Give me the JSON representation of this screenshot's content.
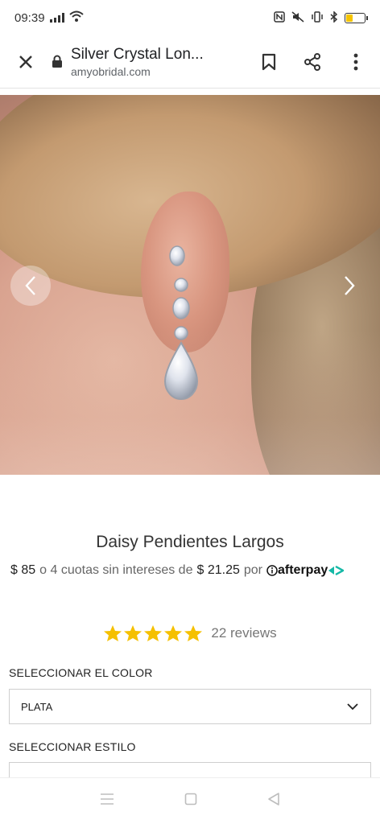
{
  "status_bar": {
    "time": "09:39",
    "icons": [
      "signal-icon",
      "wifi-icon",
      "nfc-icon",
      "mute-icon",
      "vibrate-icon",
      "bluetooth-icon",
      "battery-icon"
    ],
    "battery_color": "#f5c400"
  },
  "browser": {
    "title": "Silver Crystal Lon...",
    "url": "amyobridal.com",
    "icons": [
      "close-icon",
      "lock-icon",
      "bookmark-icon",
      "share-icon",
      "more-icon"
    ]
  },
  "gallery": {
    "prev_icon": "chevron-left-icon",
    "next_icon": "chevron-right-icon"
  },
  "product": {
    "name": "Daisy Pendientes Largos",
    "price": "$ 85",
    "installments_text": "o 4 cuotas sin intereses de",
    "installment_amount": "$ 21.25",
    "por": "por",
    "afterpay": "afterpay",
    "rating_stars": 5,
    "reviews": "22 reviews",
    "star_color": "#f5c000",
    "afterpay_accent": "#14b8a6"
  },
  "options": {
    "color_label": "SELECCIONAR EL COLOR",
    "color_value": "PLATA",
    "style_label": "SELECCIONAR ESTILO",
    "style_value": ""
  },
  "nav_bar": {
    "icons": [
      "menu-icon",
      "home-icon",
      "back-icon"
    ]
  }
}
